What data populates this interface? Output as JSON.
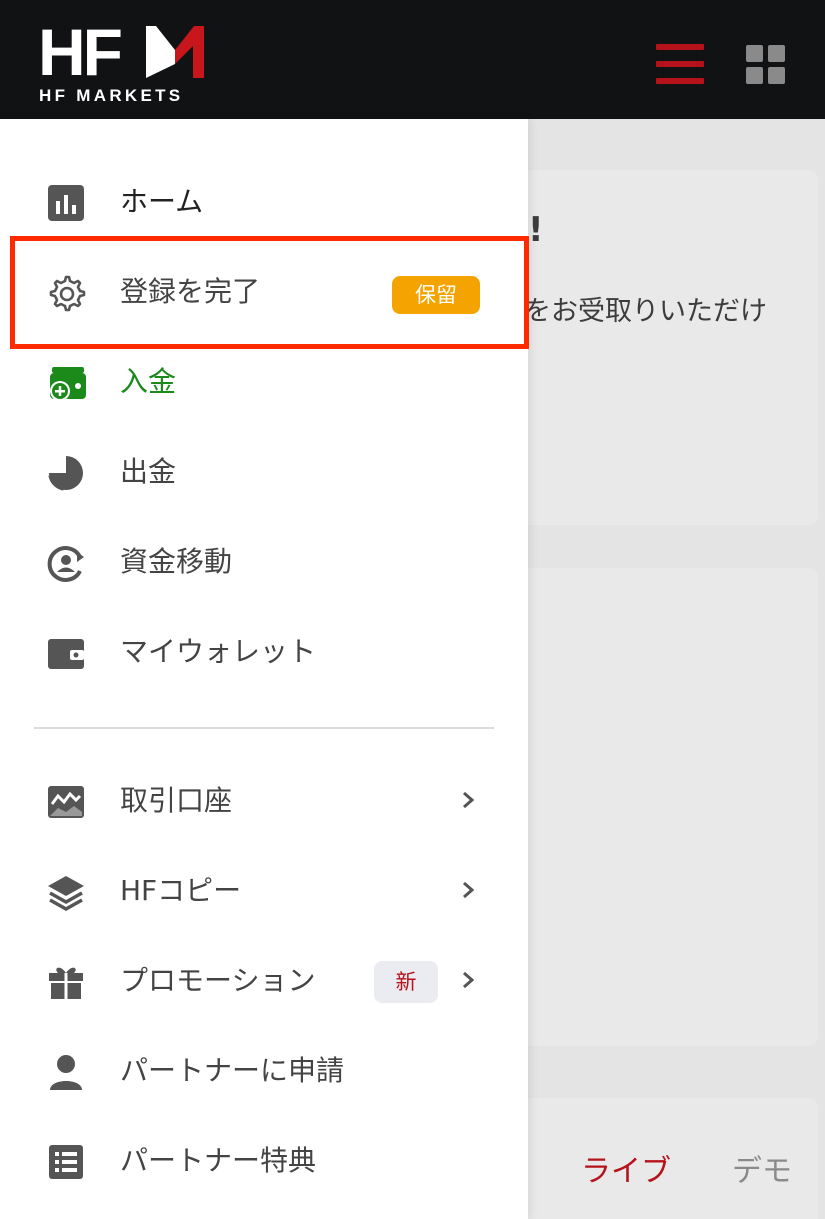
{
  "header": {
    "logo_text": "HF",
    "logo_subtitle": "HF MARKETS",
    "menu_icon": "hamburger-menu-icon",
    "apps_icon": "grid-apps-icon",
    "accent_color": "#b5121b"
  },
  "background": {
    "card1_text_a": "!",
    "card1_text_b": "をお受取りいただけ",
    "tab_live": "ライブ",
    "tab_demo": "デモ"
  },
  "drawer": {
    "items": [
      {
        "label": "ホーム",
        "icon": "bar-chart-icon"
      },
      {
        "label": "登録を完了",
        "icon": "gear-icon",
        "badge": "保留"
      },
      {
        "label": "入金",
        "icon": "wallet-plus-icon",
        "color": "#1b8a1b"
      },
      {
        "label": "出金",
        "icon": "pie-withdraw-icon"
      },
      {
        "label": "資金移動",
        "icon": "transfer-user-icon"
      },
      {
        "label": "マイウォレット",
        "icon": "wallet-icon"
      },
      {
        "label": "取引口座",
        "icon": "chart-image-icon"
      },
      {
        "label": "HFコピー",
        "icon": "layers-icon"
      },
      {
        "label": "プロモーション",
        "icon": "gift-icon",
        "badge": "新"
      },
      {
        "label": "パートナーに申請",
        "icon": "person-icon"
      },
      {
        "label": "パートナー特典",
        "icon": "list-icon"
      }
    ],
    "pending_color": "#f5a300"
  }
}
